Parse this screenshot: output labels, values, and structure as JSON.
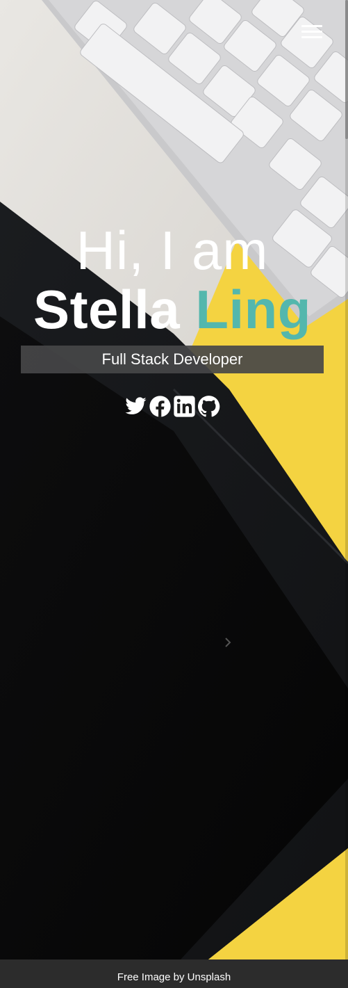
{
  "nav": {
    "menu_icon": "hamburger-menu-icon"
  },
  "hero": {
    "greeting": "Hi, I am",
    "first_name": "Stella",
    "last_name": "Ling",
    "role": "Full Stack Developer"
  },
  "social": [
    {
      "name": "twitter",
      "icon": "twitter-icon"
    },
    {
      "name": "facebook",
      "icon": "facebook-icon"
    },
    {
      "name": "linkedin",
      "icon": "linkedin-icon"
    },
    {
      "name": "github",
      "icon": "github-icon"
    }
  ],
  "footer": {
    "credit": "Free Image by Unsplash"
  },
  "colors": {
    "accent": "#53b7ad",
    "yellow": "#f5d43f",
    "footer_bg": "#2c2c2c",
    "role_box": "#464648"
  }
}
